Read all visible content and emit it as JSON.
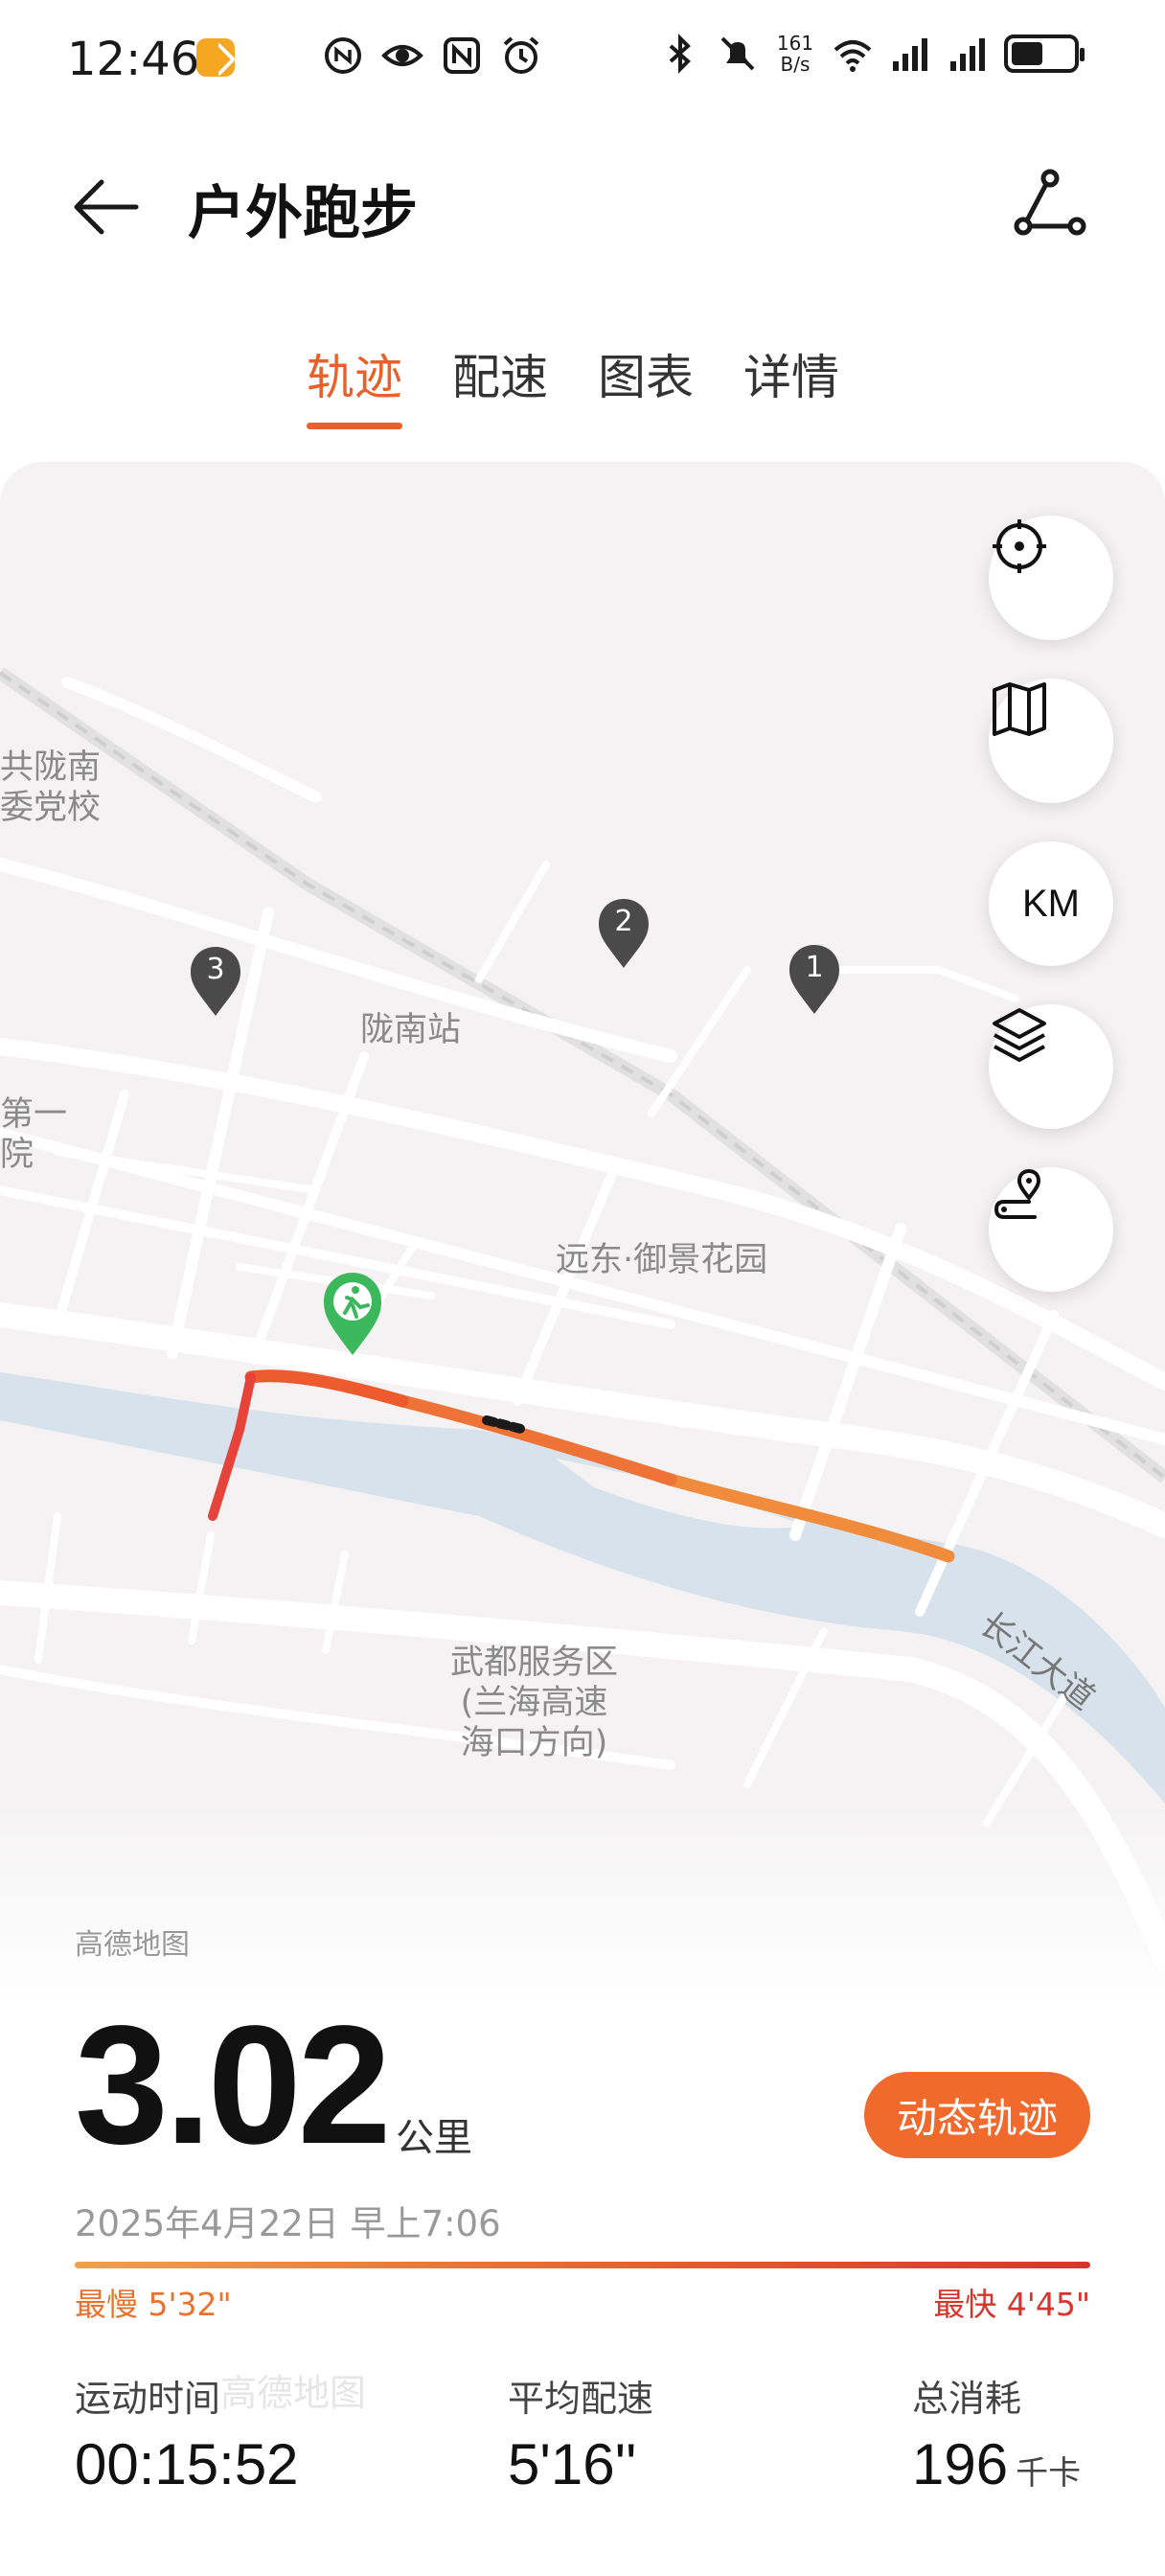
{
  "status_bar": {
    "time": "12:46",
    "net_speed_value": "161",
    "net_speed_unit": "B/s",
    "icons_left": [
      "app-badge-icon",
      "nfc-circle-icon",
      "eye-icon",
      "nfc-icon",
      "alarm-icon"
    ],
    "icons_right": [
      "bluetooth-icon",
      "mute-icon",
      "wifi-icon",
      "signal-icon",
      "signal-icon",
      "battery-icon"
    ]
  },
  "header": {
    "title": "户外跑步"
  },
  "tabs": [
    {
      "label": "轨迹",
      "active": true
    },
    {
      "label": "配速",
      "active": false
    },
    {
      "label": "图表",
      "active": false
    },
    {
      "label": "详情",
      "active": false
    }
  ],
  "map": {
    "labels": {
      "party_school": "共陇南\n委党校",
      "station": "陇南站",
      "hospital": "第一\n院",
      "garden": "远东·御景花园",
      "service_area": "武都服务区\n(兰海高速\n海口方向)",
      "road": "长江大道"
    },
    "markers": [
      "1",
      "2",
      "3"
    ],
    "controls": {
      "km_label": "KM"
    },
    "attribution": "高德地图",
    "watermark": "高德地图",
    "route_colors": {
      "slow": "#f08c3c",
      "mid": "#ec5a2e",
      "fast": "#d9342c"
    }
  },
  "summary": {
    "distance": "3.02",
    "distance_unit": "公里",
    "dynamic_button": "动态轨迹",
    "datetime": "2025年4月22日 早上7:06",
    "slowest": "最慢 5'32\"",
    "fastest": "最快 4'45\"",
    "stats": [
      {
        "label": "运动时间",
        "value": "00:15:52",
        "unit": ""
      },
      {
        "label": "平均配速",
        "value": "5'16''",
        "unit": ""
      },
      {
        "label": "总消耗",
        "value": "196",
        "unit": "千卡"
      }
    ]
  },
  "colors": {
    "accent": "#e8612a",
    "start_marker": "#3cb85c",
    "marker": "#4a4a4a"
  }
}
